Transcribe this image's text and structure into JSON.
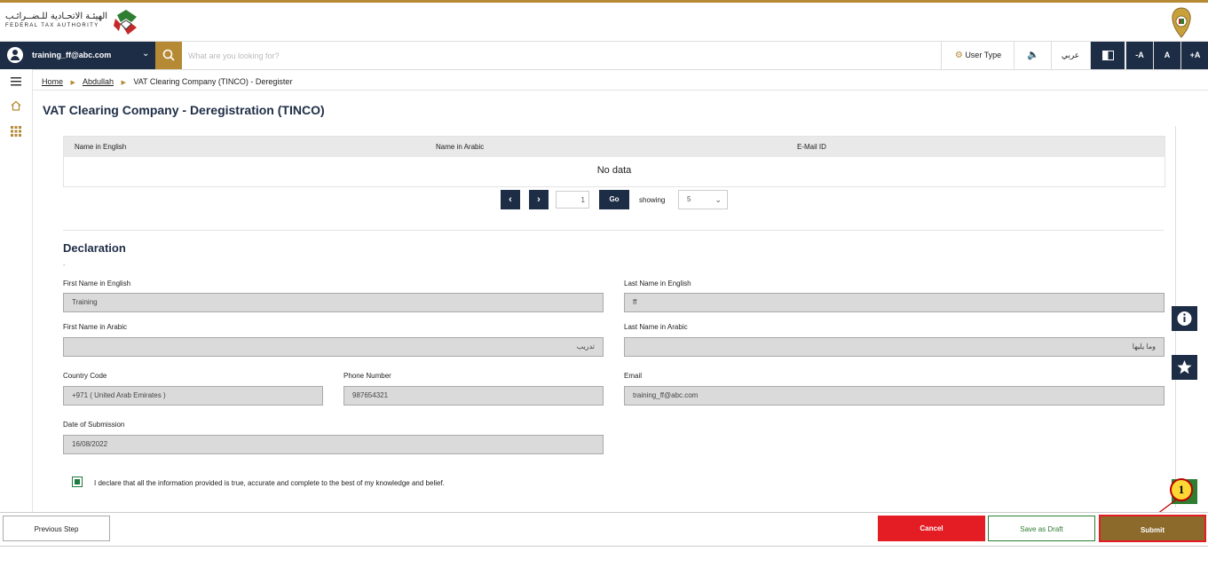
{
  "header": {
    "logo_ar": "الهيئـة الاتحـادية للـضــرائـب",
    "logo_en": "FEDERAL TAX AUTHORITY"
  },
  "navbar": {
    "user_email": "training_ff@abc.com",
    "search_placeholder": "What are you looking for?",
    "user_type": "User Type",
    "lang": "عربي",
    "font_decrease": "-A",
    "font_normal": "A",
    "font_increase": "+A"
  },
  "breadcrumb": {
    "home": "Home",
    "user": "Abdullah",
    "current": "VAT Clearing Company (TINCO) - Deregister"
  },
  "page_title": "VAT Clearing Company - Deregistration (TINCO)",
  "table": {
    "headers": [
      "Name in English",
      "Name in Arabic",
      "E-Mail ID"
    ],
    "empty_text": "No data"
  },
  "pager": {
    "page": "1",
    "go": "Go",
    "showing": "showing",
    "page_size": "5"
  },
  "declaration": {
    "title": "Declaration",
    "marker": "-",
    "first_name_en_label": "First Name in English",
    "first_name_en": "Training",
    "last_name_en_label": "Last Name in English",
    "last_name_en": "ff",
    "first_name_ar_label": "First Name in Arabic",
    "first_name_ar": "تدريب",
    "last_name_ar_label": "Last Name in Arabic",
    "last_name_ar": "وما يليها",
    "country_code_label": "Country Code",
    "country_code": "+971 ( United Arab Emirates )",
    "phone_label": "Phone Number",
    "phone": "987654321",
    "email_label": "Email",
    "email": "training_ff@abc.com",
    "date_label": "Date of Submission",
    "date": "16/08/2022",
    "consent_text": "I declare that all the information provided is true, accurate and complete to the best of my knowledge and belief."
  },
  "footer": {
    "previous": "Previous Step",
    "cancel": "Cancel",
    "save_draft": "Save as Draft",
    "submit": "Submit"
  },
  "annotation": {
    "step_number": "1"
  },
  "colors": {
    "navy": "#1e2d46",
    "gold": "#b68a35",
    "submit_brown": "#8b6a2b",
    "cancel_red": "#e41c23",
    "draft_green": "#2e7d32"
  }
}
